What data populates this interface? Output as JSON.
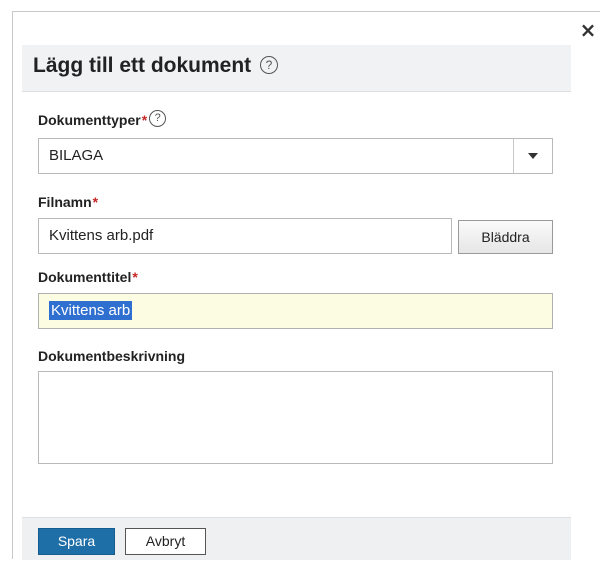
{
  "dialog": {
    "close_icon": "×",
    "title": "Lägg till ett dokument",
    "help_icon": "?"
  },
  "fields": {
    "document_types": {
      "label": "Dokumenttyper",
      "required_mark": "*",
      "help_icon": "?",
      "value": "BILAGA"
    },
    "filename": {
      "label": "Filnamn",
      "required_mark": "*",
      "value": "Kvittens arb.pdf",
      "browse_label": "Bläddra"
    },
    "document_title": {
      "label": "Dokumenttitel",
      "required_mark": "*",
      "value": "Kvittens arb"
    },
    "document_description": {
      "label": "Dokumentbeskrivning",
      "value": ""
    }
  },
  "footer": {
    "save_label": "Spara",
    "cancel_label": "Avbryt"
  },
  "colors": {
    "primary_button": "#1e6fa8",
    "required_mark": "#c62828",
    "selection_highlight": "#2f6fd0",
    "focused_input_bg": "#fcfce3"
  }
}
